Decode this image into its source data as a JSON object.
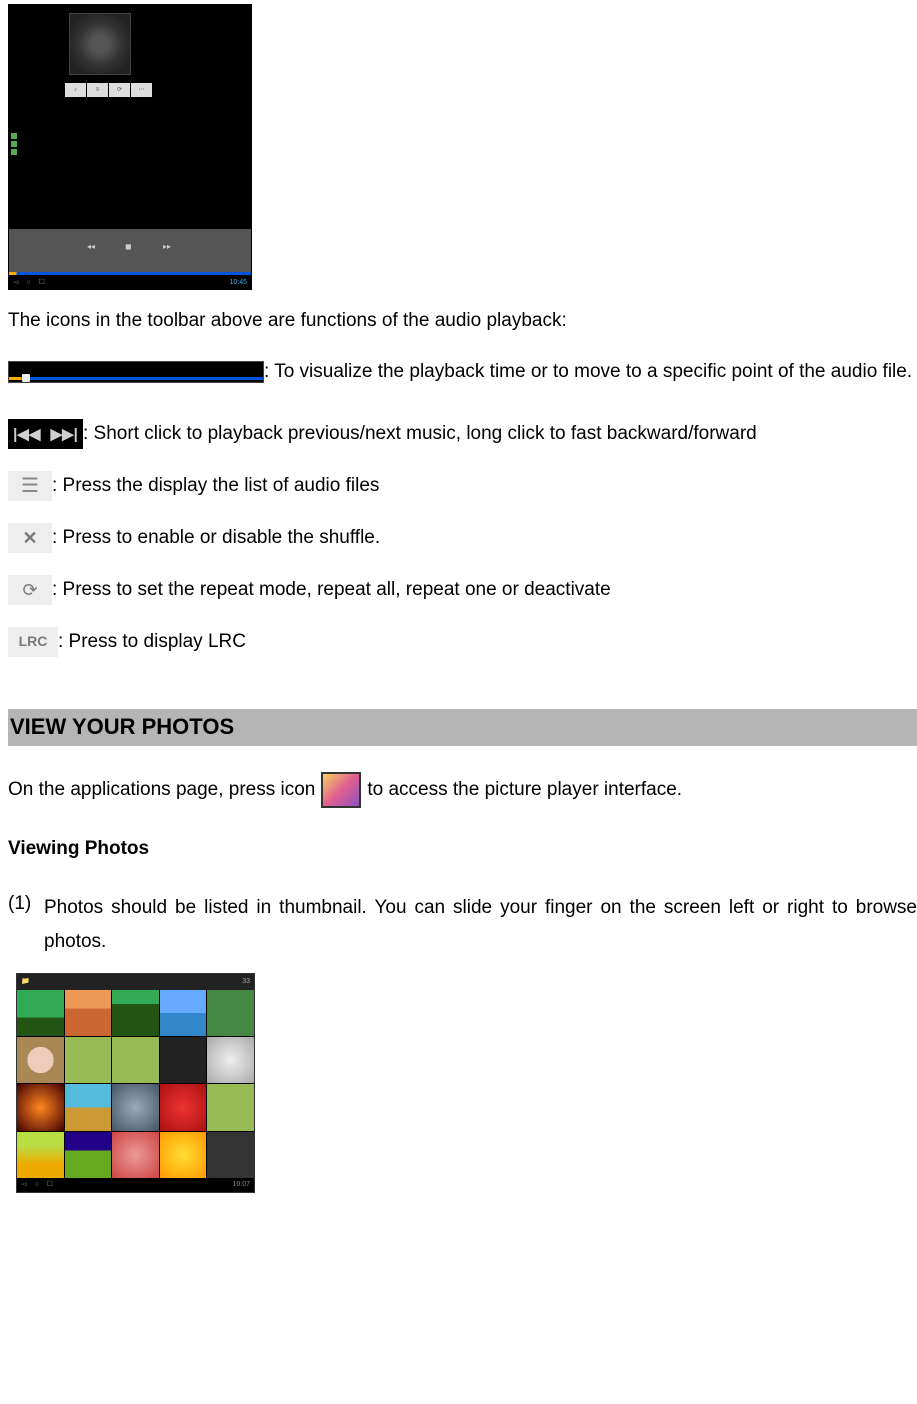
{
  "player_screenshot": {
    "sidebar_items": [
      "",
      "",
      ""
    ],
    "time_indicator": "10:45"
  },
  "intro": "The icons in the toolbar above are functions of the audio playback:",
  "items": {
    "seekbar": " : To visualize the playback time or to move to a specific point of the audio file.",
    "prevnext": ": Short click to playback previous/next music, long click to fast backward/forward",
    "list": ": Press the display the list of audio files",
    "shuffle": ": Press to enable or disable the shuffle.",
    "repeat": ": Press to set the repeat mode, repeat all, repeat one or deactivate",
    "lrc_label": "LRC",
    "lrc": ": Press to display LRC"
  },
  "section": "VIEW YOUR PHOTOS",
  "photo_intro_prefix": "On the applications page, press icon ",
  "photo_intro_suffix": " to access the picture player interface.",
  "subheading": "Viewing Photos",
  "list_1_num": "(1)",
  "list_1": "Photos should be listed in thumbnail. You can slide your finger on the screen left or right to browse photos.",
  "gallery_screenshot": {
    "count": "33",
    "time": "10:07"
  }
}
